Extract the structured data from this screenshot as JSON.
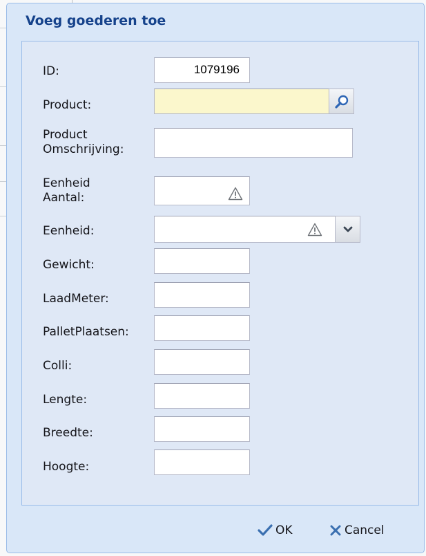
{
  "dialog": {
    "title": "Voeg goederen toe"
  },
  "form": {
    "id_label": "ID:",
    "id_value": "1079196",
    "product_label": "Product:",
    "product_value": "",
    "omschrijving_label": "Product Omschrijving:",
    "omschrijving_value": "",
    "eenheid_aantal_label": "Eenheid Aantal:",
    "eenheid_aantal_value": "",
    "eenheid_label": "Eenheid:",
    "eenheid_value": "",
    "gewicht_label": "Gewicht:",
    "laadmeter_label": "LaadMeter:",
    "palletplaatsen_label": "PalletPlaatsen:",
    "colli_label": "Colli:",
    "lengte_label": "Lengte:",
    "breedte_label": "Breedte:",
    "hoogte_label": "Hoogte:"
  },
  "buttons": {
    "ok_label": "OK",
    "cancel_label": "Cancel"
  },
  "icons": {
    "product_search": "search-icon",
    "eenheid_aantal_warning": "warning-icon",
    "eenheid_warning": "warning-icon",
    "eenheid_dropdown": "chevron-down-icon",
    "ok": "checkmark-icon",
    "cancel": "close-icon"
  },
  "colors": {
    "title_text": "#15428b",
    "window_bg": "#d9e7f8",
    "body_bg": "#dfe8f6",
    "required_field_bg": "#fbf7cc",
    "button_icon": "#3a6fb0"
  }
}
